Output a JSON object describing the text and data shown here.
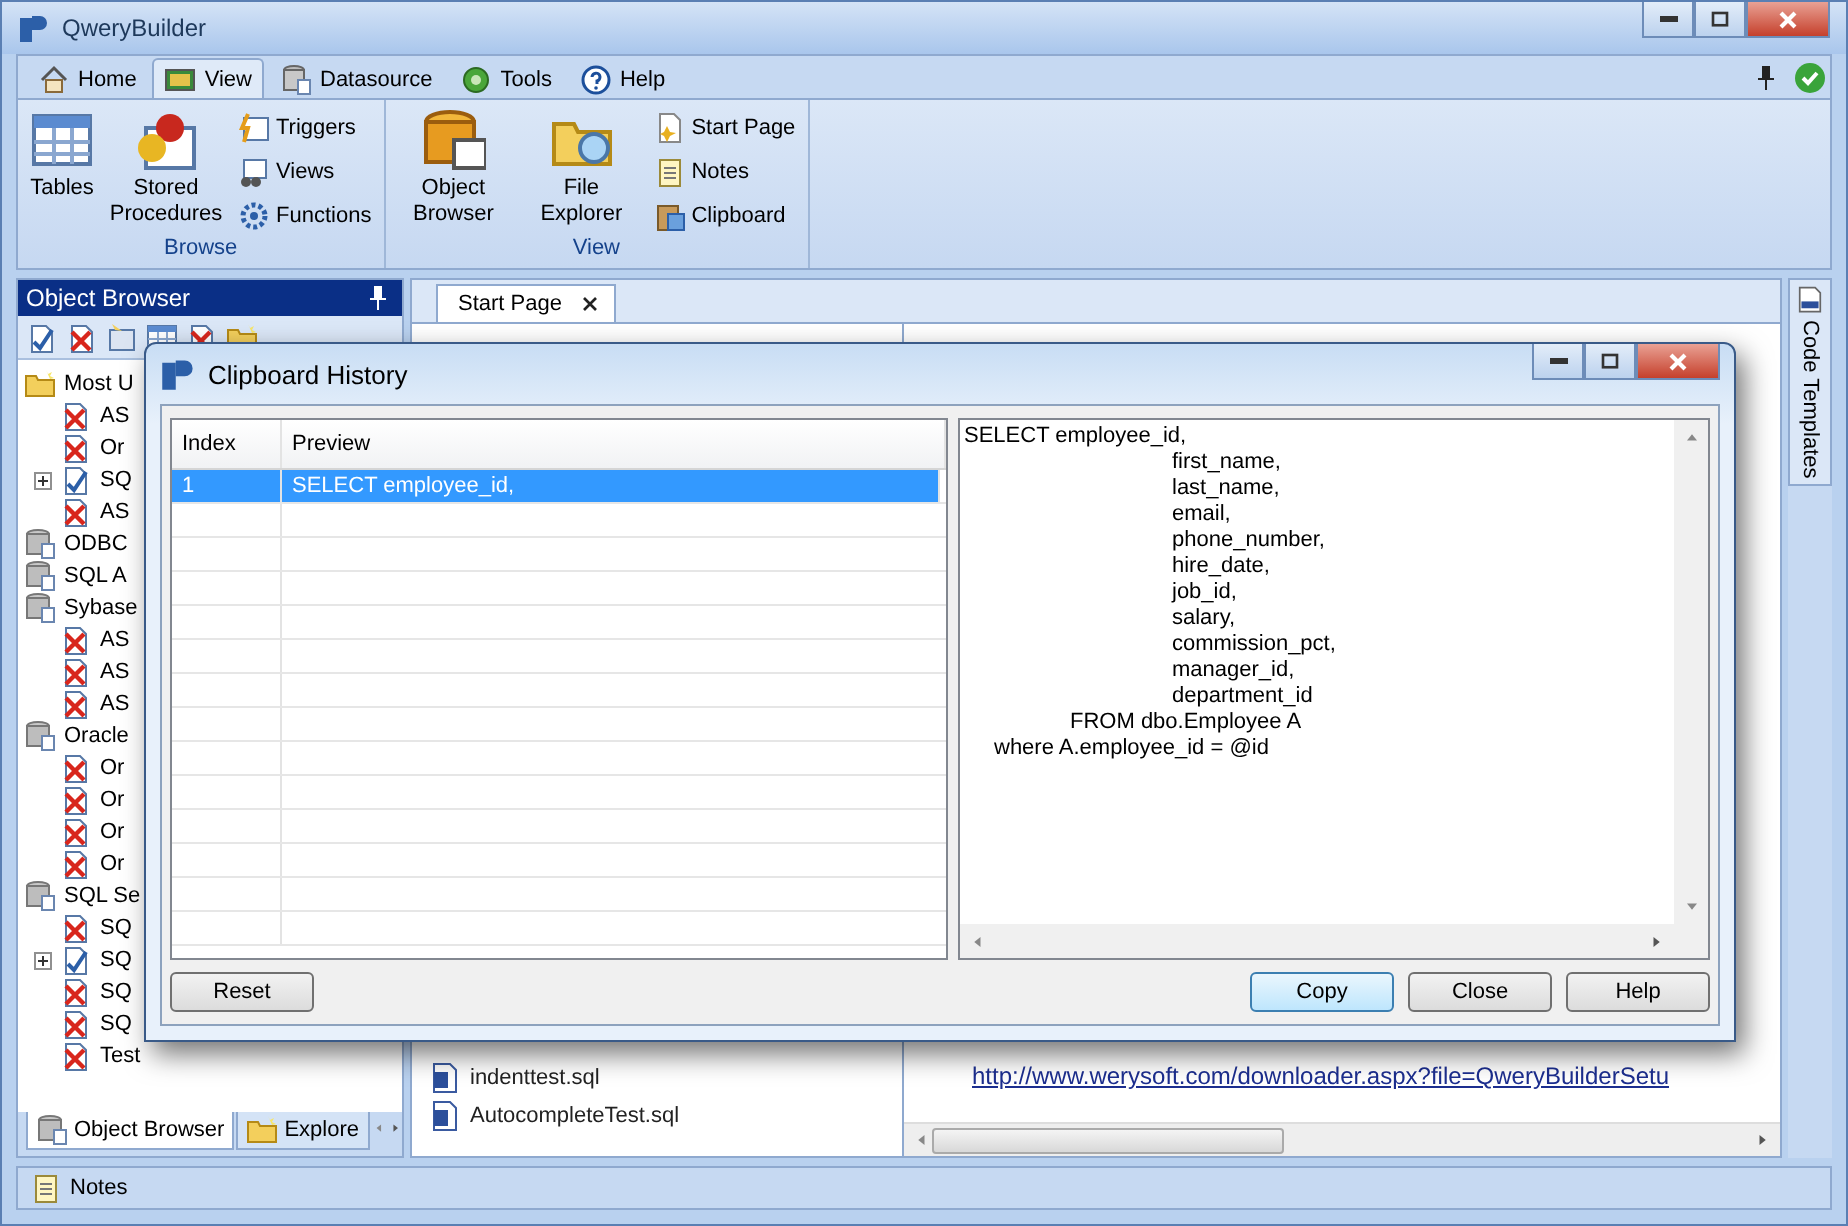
{
  "window": {
    "title": "QweryBuilder"
  },
  "ribbon_tabs": [
    {
      "label": "Home",
      "selected": false
    },
    {
      "label": "View",
      "selected": true
    },
    {
      "label": "Datasource",
      "selected": false
    },
    {
      "label": "Tools",
      "selected": false
    },
    {
      "label": "Help",
      "selected": false
    }
  ],
  "ribbon_groups": [
    {
      "label": "Browse",
      "large": [
        {
          "label": "Tables"
        },
        {
          "label": "Stored Procedures"
        }
      ],
      "small": [
        {
          "label": "Triggers"
        },
        {
          "label": "Views"
        },
        {
          "label": "Functions"
        }
      ]
    },
    {
      "label": "View",
      "large": [
        {
          "label": "Object Browser"
        },
        {
          "label": "File Explorer"
        }
      ],
      "small": [
        {
          "label": "Start Page"
        },
        {
          "label": "Notes"
        },
        {
          "label": "Clipboard"
        }
      ]
    }
  ],
  "object_browser": {
    "title": "Object Browser",
    "tree": [
      {
        "label": "Most U",
        "kind": "folder",
        "children": [
          {
            "label": "AS",
            "kind": "error"
          },
          {
            "label": "Or",
            "kind": "error"
          },
          {
            "label": "SQ",
            "kind": "connection",
            "expanded": false
          },
          {
            "label": "AS",
            "kind": "error"
          }
        ]
      },
      {
        "label": "ODBC",
        "kind": "database"
      },
      {
        "label": "SQL A",
        "kind": "database"
      },
      {
        "label": "Sybase",
        "kind": "database",
        "children": [
          {
            "label": "AS",
            "kind": "error"
          },
          {
            "label": "AS",
            "kind": "error"
          },
          {
            "label": "AS",
            "kind": "error"
          }
        ]
      },
      {
        "label": "Oracle",
        "kind": "database",
        "children": [
          {
            "label": "Or",
            "kind": "error"
          },
          {
            "label": "Or",
            "kind": "error"
          },
          {
            "label": "Or",
            "kind": "error"
          },
          {
            "label": "Or",
            "kind": "error"
          }
        ]
      },
      {
        "label": "SQL Se",
        "kind": "database",
        "children": [
          {
            "label": "SQ",
            "kind": "error"
          },
          {
            "label": "SQ",
            "kind": "connection",
            "expanded": false
          },
          {
            "label": "SQ",
            "kind": "error"
          },
          {
            "label": "SQ",
            "kind": "error"
          },
          {
            "label": "Test",
            "kind": "error"
          }
        ]
      }
    ],
    "tabs": [
      {
        "label": "Object Browser",
        "selected": true
      },
      {
        "label": "Explore",
        "selected": false
      }
    ]
  },
  "document_tabs": [
    {
      "label": "Start Page",
      "selected": true
    }
  ],
  "start_page": {
    "files": [
      "indenttest.sql",
      "AutocompleteTest.sql"
    ],
    "link": "http://www.werysoft.com/downloader.aspx?file=QweryBuilderSetu"
  },
  "side_tab": {
    "label": "Code Templates"
  },
  "status_bar": {
    "label": "Notes"
  },
  "dialog": {
    "title": "Clipboard History",
    "columns": [
      "Index",
      "Preview"
    ],
    "rows": [
      {
        "index": "1",
        "preview": "SELECT employee_id,",
        "selected": true
      }
    ],
    "preview_lines": [
      {
        "text": "SELECT employee_id,",
        "kind": "clause"
      },
      {
        "text": "first_name,",
        "kind": "column"
      },
      {
        "text": "last_name,",
        "kind": "column"
      },
      {
        "text": "email,",
        "kind": "column"
      },
      {
        "text": "phone_number,",
        "kind": "column"
      },
      {
        "text": "hire_date,",
        "kind": "column"
      },
      {
        "text": "job_id,",
        "kind": "column"
      },
      {
        "text": "salary,",
        "kind": "column"
      },
      {
        "text": "commission_pct,",
        "kind": "column"
      },
      {
        "text": "manager_id,",
        "kind": "column"
      },
      {
        "text": "department_id",
        "kind": "column"
      },
      {
        "text": "FROM dbo.Employee A",
        "kind": "from"
      },
      {
        "text": "where A.employee_id = @id",
        "kind": "where"
      }
    ],
    "buttons": [
      {
        "label": "Reset",
        "focused": false
      },
      {
        "label": "Copy",
        "focused": true
      },
      {
        "label": "Close",
        "focused": false
      },
      {
        "label": "Help",
        "focused": false
      }
    ]
  }
}
